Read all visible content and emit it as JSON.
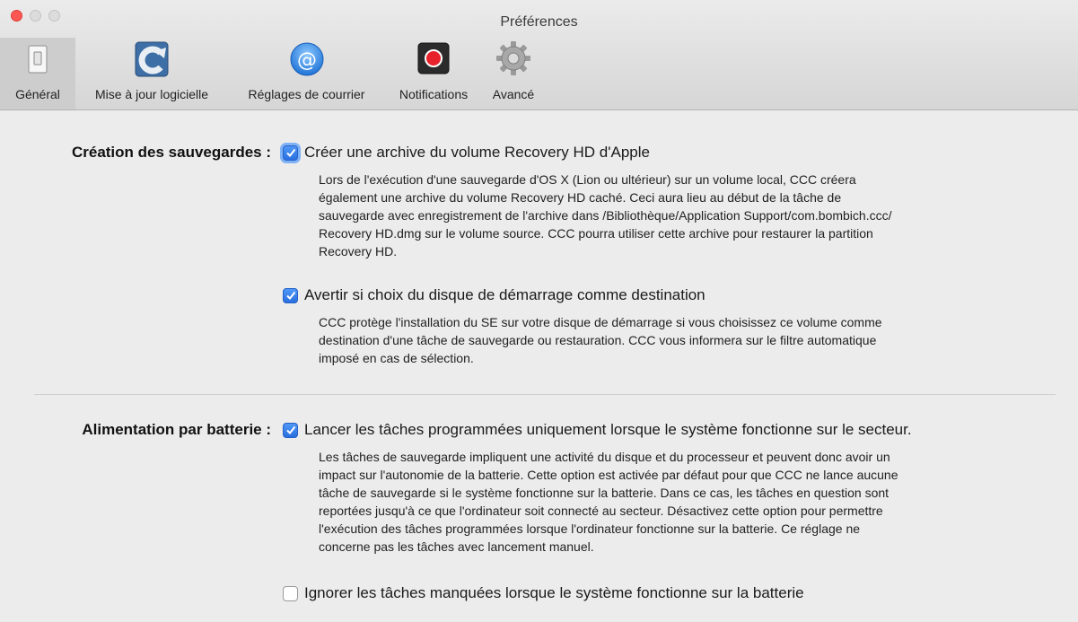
{
  "window": {
    "title": "Préférences"
  },
  "toolbar": {
    "tabs": [
      {
        "label": "Général",
        "icon": "switch-icon",
        "selected": true
      },
      {
        "label": "Mise à jour logicielle",
        "icon": "ccc-update-icon"
      },
      {
        "label": "Réglages de courrier",
        "icon": "mail-at-icon"
      },
      {
        "label": "Notifications",
        "icon": "notification-record-icon"
      },
      {
        "label": "Avancé",
        "icon": "gear-icon"
      }
    ]
  },
  "backup": {
    "section_label": "Création des sauvegardes :",
    "option1": {
      "label": "Créer une archive du volume Recovery HD d'Apple",
      "checked": true,
      "desc_lines": [
        "Lors de l'exécution d'une sauvegarde d'OS X (Lion ou ultérieur) sur un volume local, CCC créera",
        "également une archive du volume Recovery HD caché. Ceci aura lieu au début de la tâche de",
        "sauvegarde avec enregistrement de l'archive dans /Bibliothèque/Application Support/com.bombich.ccc/",
        "Recovery HD.dmg sur le volume source. CCC pourra utiliser cette archive pour restaurer la partition",
        "Recovery HD."
      ]
    },
    "option2": {
      "label": "Avertir si choix du disque de démarrage comme destination",
      "checked": true,
      "desc_lines": [
        "CCC protège l'installation du SE sur votre disque de démarrage si vous choisissez ce volume comme",
        "destination d'une tâche de sauvegarde ou restauration. CCC vous informera sur le filtre automatique",
        "imposé en cas de sélection."
      ]
    }
  },
  "battery": {
    "section_label": "Alimentation par batterie :",
    "option1": {
      "label": "Lancer les tâches programmées uniquement lorsque le système fonctionne sur le secteur.",
      "checked": true,
      "desc_lines": [
        "Les tâches de sauvegarde impliquent une activité du disque et du processeur et peuvent donc avoir un",
        "impact sur l'autonomie de la batterie. Cette option est activée par défaut pour que CCC ne lance aucune",
        "tâche de sauvegarde si le système fonctionne sur la batterie. Dans ce cas, les tâches en question sont",
        "reportées jusqu'à ce que l'ordinateur soit connecté au secteur. Désactivez cette option pour permettre",
        "l'exécution des tâches programmées lorsque l'ordinateur fonctionne sur la batterie. Ce réglage ne",
        "concerne pas les tâches avec lancement manuel."
      ]
    },
    "option2": {
      "label": "Ignorer les tâches manquées lorsque le système fonctionne sur la batterie",
      "checked": false
    }
  },
  "colors": {
    "checkbox_accent": "#2a6fe0",
    "close_button": "#fc5753",
    "window_bg": "#ececec"
  }
}
